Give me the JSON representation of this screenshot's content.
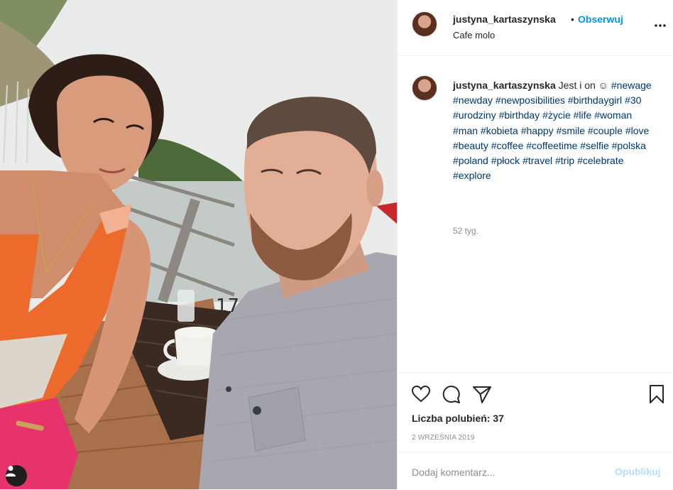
{
  "post": {
    "photo": {
      "table_number": "17",
      "tag_icon": "person-icon"
    },
    "header": {
      "username": "justyna_kartaszynska",
      "separator": "•",
      "follow_label": "Obserwuj",
      "location": "Cafe molo",
      "more_icon": "more-horizontal-icon"
    },
    "caption": {
      "username": "justyna_kartaszynska",
      "text": "Jest i on ☺",
      "hashtags": "#newage #newday #newposibilities #birthdaygirl #30 #urodziny #birthday #życie #life #woman #man #kobieta #happy #smile #couple #love #beauty #coffee #coffeetime #selfie #polska #poland #płock #travel #trip #celebrate #explore",
      "time_ago": "52 tyg."
    },
    "actions": {
      "icons": [
        "heart-icon",
        "comment-icon",
        "share-icon",
        "bookmark-icon"
      ],
      "likes_label": "Liczba polubień: 37",
      "date": "2 WRZEŚNIA 2019"
    },
    "comment": {
      "placeholder": "Dodaj komentarz...",
      "publish_label": "Opublikuj"
    },
    "colors": {
      "link_blue": "#0095f6",
      "hashtag_blue": "#00376b",
      "publish_disabled": "#b2dffc",
      "muted_gray": "#8e8e8e",
      "border": "#efefef"
    }
  }
}
